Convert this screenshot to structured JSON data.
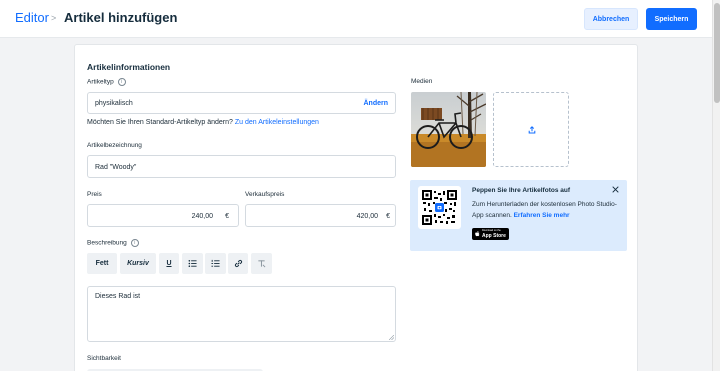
{
  "header": {
    "breadcrumb_root": "Editor",
    "breadcrumb_separator": ">",
    "title": "Artikel hinzufügen",
    "cancel_label": "Abbrechen",
    "save_label": "Speichern"
  },
  "form": {
    "section_title": "Artikelinformationen",
    "type": {
      "label": "Artikeltyp",
      "value": "physikalisch",
      "change_label": "Ändern",
      "hint_text": "Möchten Sie Ihren Standard-Artikeltyp ändern?",
      "hint_link": "Zu den Artikeleinstellungen"
    },
    "name": {
      "label": "Artikelbezeichnung",
      "value": "Rad \"Woody\""
    },
    "price": {
      "label": "Preis",
      "value": "240,00",
      "currency": "€"
    },
    "sale_price": {
      "label": "Verkaufspreis",
      "value": "420,00",
      "currency": "€"
    },
    "description": {
      "label": "Beschreibung",
      "value": "Dieses Rad ist",
      "toolbar": {
        "bold": "Fett",
        "italic": "Kursiv",
        "underline": "U"
      }
    },
    "visibility": {
      "label": "Sichtbarkeit"
    }
  },
  "media": {
    "label": "Medien",
    "banner": {
      "title": "Peppen Sie Ihre Artikelfotos auf",
      "text": "Zum Herunterladen der kostenlosen Photo Studio-App scannen.",
      "link": "Erfahren Sie mehr",
      "appstore_small": "Download on the",
      "appstore_big": "App Store"
    }
  },
  "icons": {
    "info": "info-icon",
    "upload": "upload-icon",
    "close": "close-icon",
    "link": "link-icon",
    "clear_format": "clear-format-icon"
  },
  "colors": {
    "accent": "#116dff",
    "banner_bg": "#dcebfd",
    "toolbar_bg": "#eef1f4"
  }
}
